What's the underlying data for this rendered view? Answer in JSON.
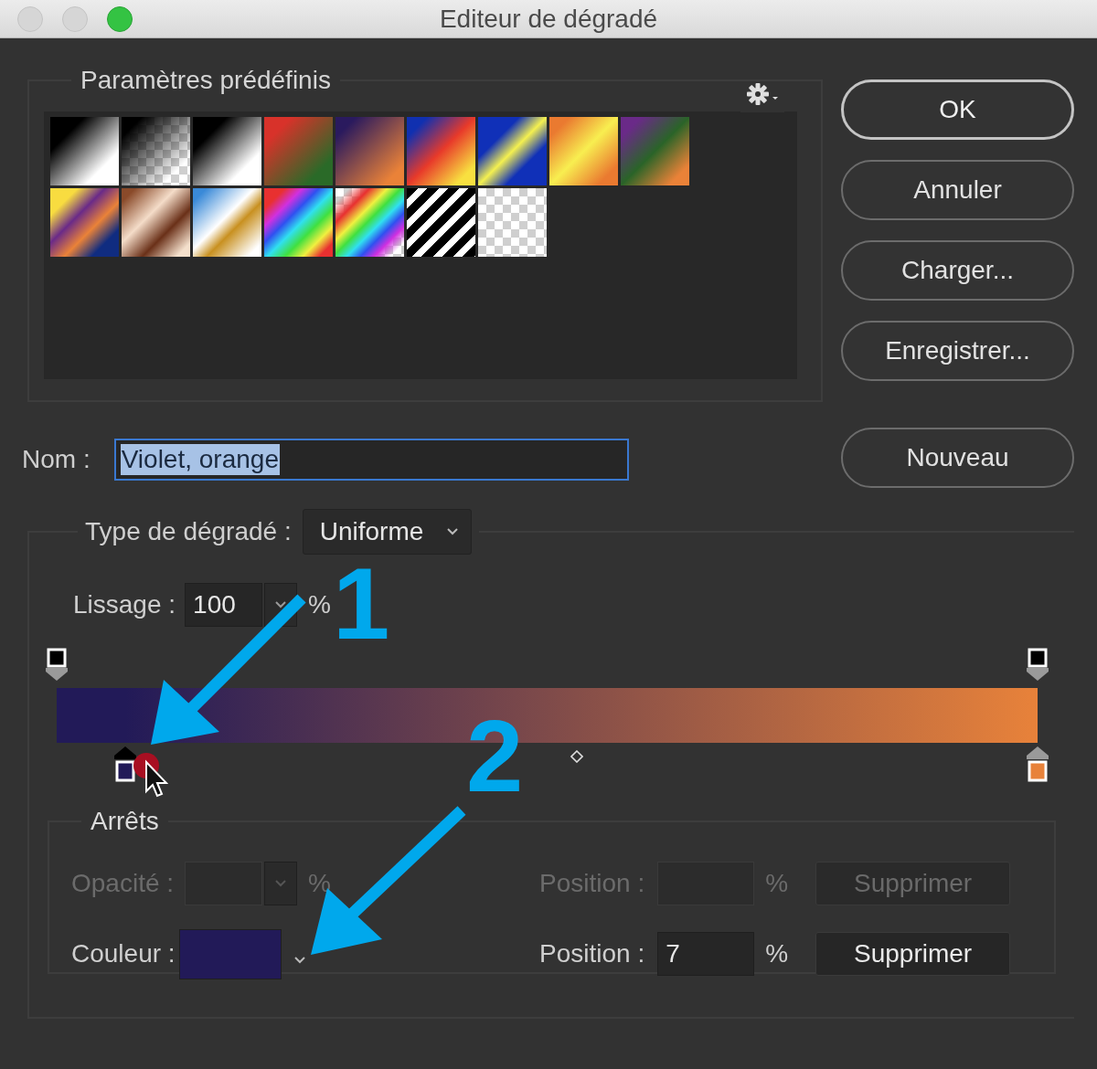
{
  "window": {
    "title": "Editeur de dégradé"
  },
  "presets": {
    "title": "Paramètres prédéfinis",
    "swatches": [
      {
        "kind": "blackwhite"
      },
      {
        "kind": "blackfade"
      },
      {
        "kind": "blackwhite"
      },
      {
        "kind": "redgreen"
      },
      {
        "kind": "violetorange"
      },
      {
        "kind": "blueredyellow"
      },
      {
        "kind": "blueyellowblue"
      },
      {
        "kind": "orangeyellow"
      },
      {
        "kind": "violetgreenorange"
      },
      {
        "kind": "yellowvioletorangeblue"
      },
      {
        "kind": "copper"
      },
      {
        "kind": "chrome"
      },
      {
        "kind": "spectrum"
      },
      {
        "kind": "rainbowfade"
      },
      {
        "kind": "stripes"
      },
      {
        "kind": "transparent"
      }
    ]
  },
  "buttons": [
    {
      "label": "OK",
      "default": true
    },
    {
      "label": "Annuler",
      "default": false
    },
    {
      "label": "Charger...",
      "default": false
    },
    {
      "label": "Enregistrer...",
      "default": false
    }
  ],
  "name": {
    "label": "Nom :",
    "value": "Violet, orange",
    "text_selected": true
  },
  "new_button": {
    "label": "Nouveau"
  },
  "gradient_type": {
    "label": "Type de dégradé :",
    "value": "Uniforme"
  },
  "smoothness": {
    "label": "Lissage :",
    "value": "100",
    "unit": "%"
  },
  "gradient": {
    "opacity_stops": [
      {
        "level": 0,
        "selected": false
      },
      {
        "level": 1,
        "selected": false
      }
    ],
    "color_stops": [
      {
        "level": 0.07,
        "color": "#221a58",
        "selected": true
      },
      {
        "level": 1,
        "color": "#e8823a",
        "selected": false
      }
    ],
    "midpoint": {
      "level": 0.53
    }
  },
  "stops_panel": {
    "title": "Arrêts",
    "opacity_row": {
      "label": "Opacité :",
      "unit": "%",
      "position_label": "Position :",
      "position_unit": "%",
      "delete_label": "Supprimer",
      "disabled": true
    },
    "color_row": {
      "label": "Couleur :",
      "color": "#221a58",
      "position_label": "Position :",
      "position_value": "7",
      "position_unit": "%",
      "delete_label": "Supprimer",
      "disabled": false
    }
  },
  "annotations": [
    {
      "label": "1"
    },
    {
      "label": "2"
    }
  ]
}
